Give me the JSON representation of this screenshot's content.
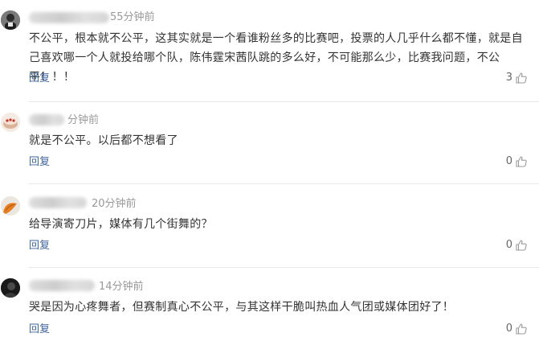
{
  "comments": [
    {
      "time": "55分钟前",
      "text": "不公平，根本就不公平，这其实就是一个看谁粉丝多的比赛吧，投票的人几乎什么都不懂，就是自己喜欢哪一个人就投给哪个队，陈伟霆宋茜队跳的多么好，不可能那么少，比赛我问题，不公平！！！",
      "reply_label": "回复",
      "likes": "3",
      "avatar_icon": "user-avatar-dark"
    },
    {
      "time": "分钟前",
      "text": "就是不公平。以后都不想看了",
      "reply_label": "回复",
      "likes": "0",
      "avatar_icon": "user-avatar-cake"
    },
    {
      "time": "20分钟前",
      "text": "给导演寄刀片，媒体有几个街舞的？",
      "reply_label": "回复",
      "likes": "0",
      "avatar_icon": "user-avatar-orange"
    },
    {
      "time": "14分钟前",
      "text": "哭是因为心疼舞者，但赛制真心不公平，与其这样干脆叫热血人气团或媒体团好了！",
      "reply_label": "回复",
      "likes": "0",
      "avatar_icon": "user-avatar-black"
    }
  ],
  "colors": {
    "reply_link": "#406599",
    "meta_text": "#999999",
    "body_text": "#333333",
    "divider": "#e8e8e8"
  }
}
